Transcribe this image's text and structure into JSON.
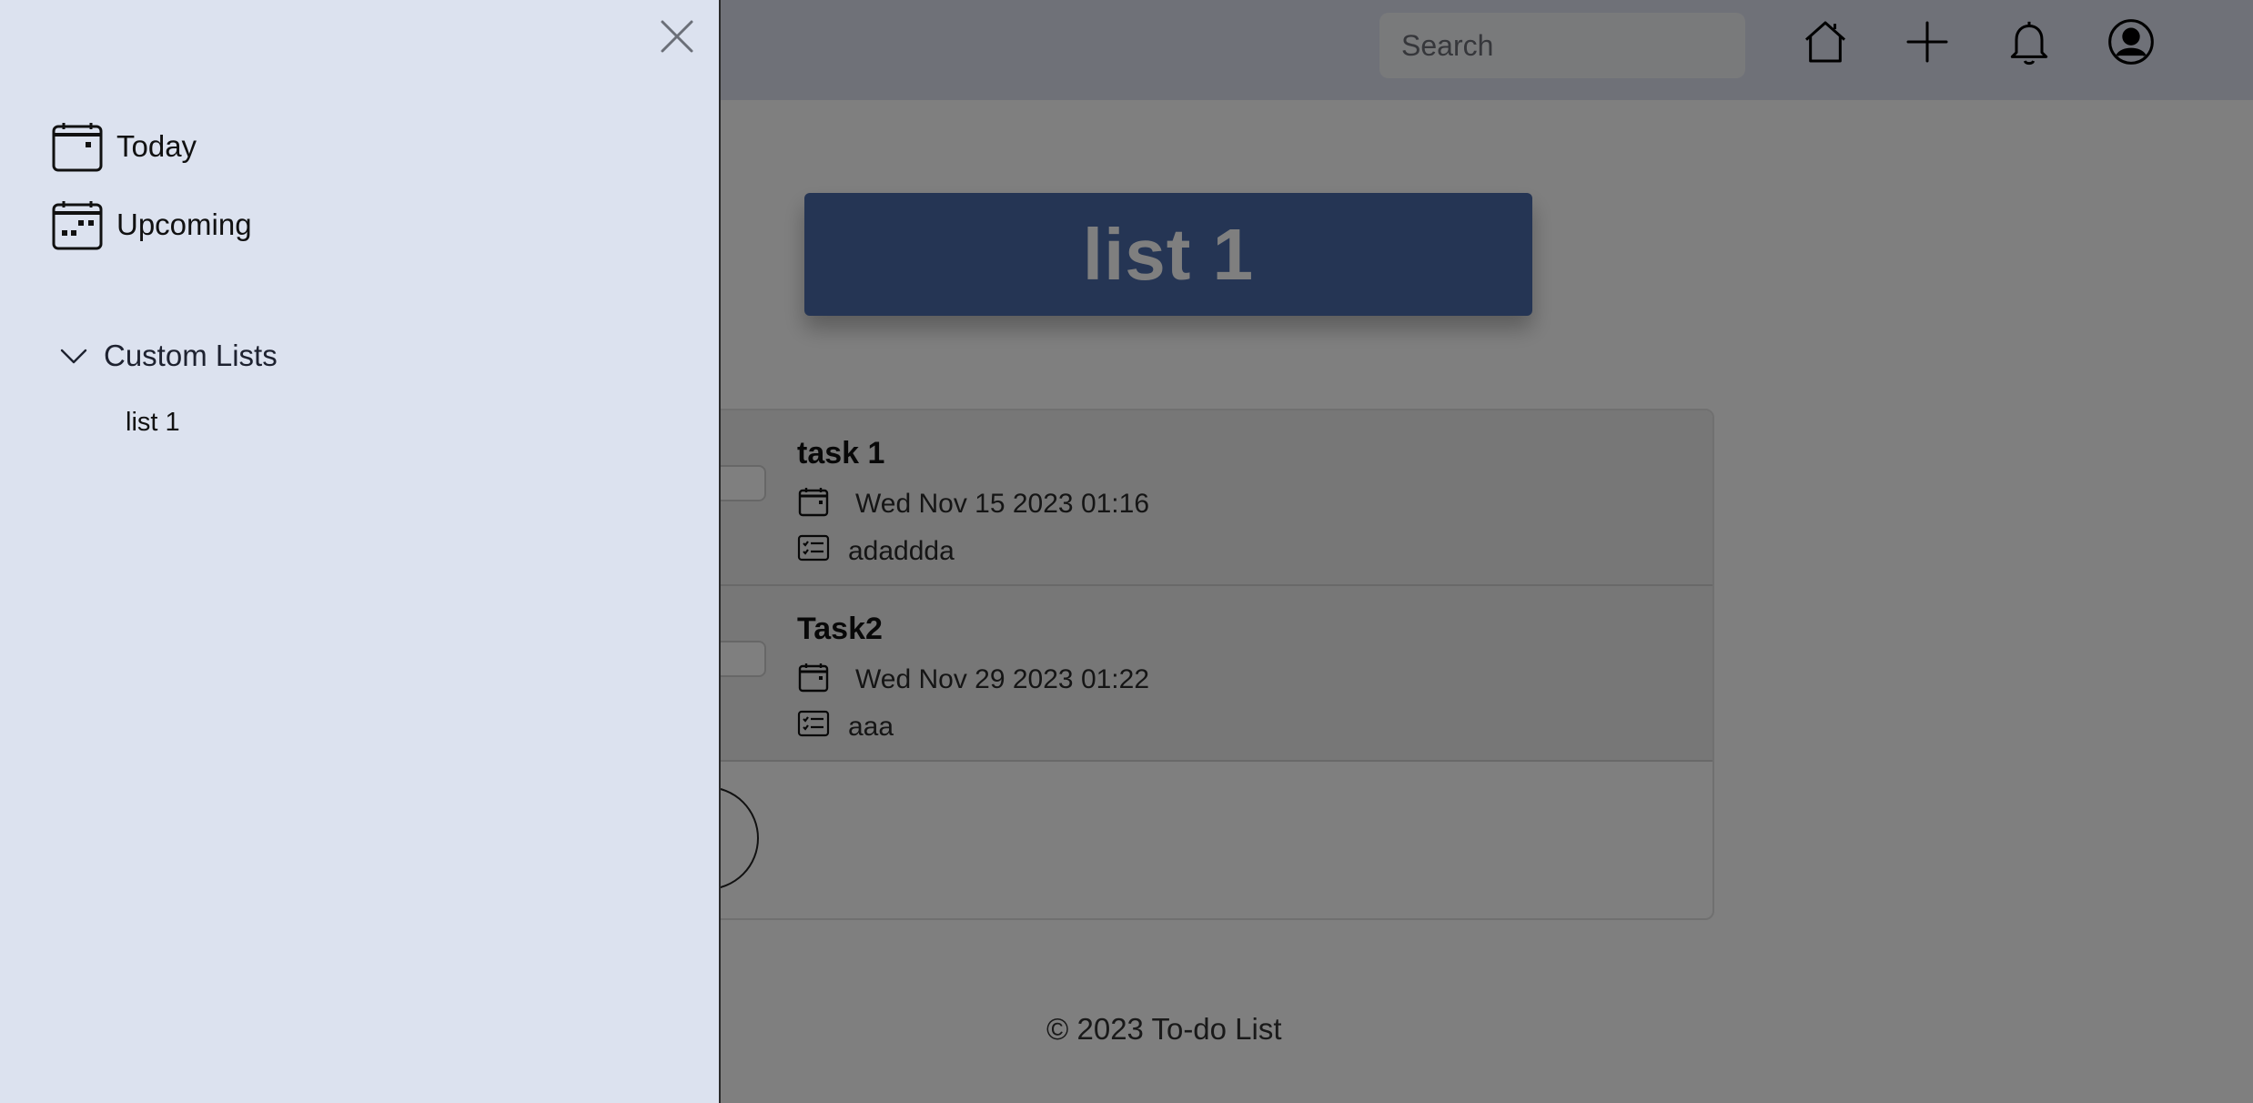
{
  "header": {
    "search_placeholder": "Search",
    "icons": [
      "home-icon",
      "plus-icon",
      "bell-icon",
      "account-icon"
    ]
  },
  "main": {
    "list_title": "list 1",
    "tasks": [
      {
        "name": "task 1",
        "date": "Wed Nov 15 2023 01:16",
        "description": "adaddda"
      },
      {
        "name": "Task2",
        "date": "Wed Nov 29 2023 01:22",
        "description": "aaa"
      }
    ]
  },
  "footer": {
    "text": "© 2023 To-do List"
  },
  "sidebar": {
    "close_icon": "close-icon",
    "items": [
      {
        "label": "Today",
        "icon": "calendar-today-icon"
      },
      {
        "label": "Upcoming",
        "icon": "calendar-upcoming-icon"
      }
    ],
    "custom_lists": {
      "label": "Custom Lists",
      "expanded": true,
      "items": [
        "list 1"
      ]
    }
  },
  "colors": {
    "navbar_bg": "#dee3f0",
    "sidebar_bg": "#dce2ef",
    "title_card_bg": "#4a6aa8",
    "overlay": "rgba(0,0,0,0.5)"
  }
}
